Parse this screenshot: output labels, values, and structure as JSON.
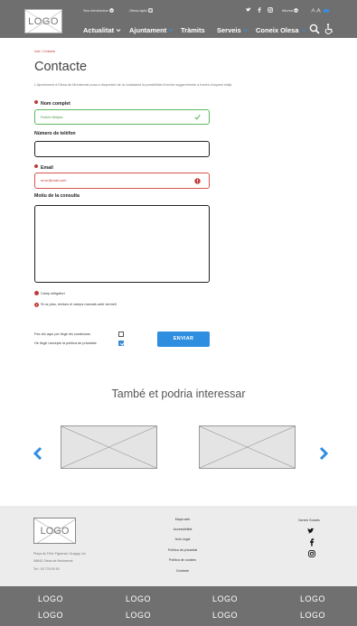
{
  "header": {
    "logo_text": "LOGO",
    "topbar": {
      "seu_electronica": "Seu electrònica",
      "olesa_aplic": "Olesa Aplic",
      "idioma": "Idioma"
    },
    "nav": {
      "actualitat": "Actualitat",
      "ajuntament": "Ajuntament",
      "tramits": "Tràmits",
      "serveis": "Serveis",
      "coneix_olesa": "Coneix Olesa"
    },
    "icons": [
      "twitter-icon",
      "facebook-icon",
      "instagram-icon",
      "search-icon",
      "accessibility-icon"
    ],
    "accent_color": "#3c8ad6"
  },
  "breadcrumb": "Inici / Contacte",
  "page_title": "Contacte",
  "intro": "L'Ajuntament d'Olesa de Montserrat posa a disposició de la ciutadania la possibilitat d'enviar suggeriments a través d'aquest mitjà.",
  "form": {
    "name_label": "Nom complet",
    "name_value": "Rubén Mejias",
    "phone_label": "Número de telèfon",
    "phone_value": "",
    "email_label": "Email",
    "email_value": "error@mail.com",
    "message_label": "Motiu de la consulta",
    "message_value": "",
    "required_note": "Camp obligatori",
    "error_note": "Si us plau, reviseu el camps marcats amb vermell",
    "conditions_label": "Fes clic aquí per llegir les condicions",
    "conditions_checked": false,
    "privacy_label": "He llegit i accepto la política de privacitat",
    "privacy_checked": true,
    "submit_label": "ENVIAR",
    "ok_color": "#5cb85c",
    "error_color": "#d9534f"
  },
  "related": {
    "title": "També et podria interessar",
    "prev_icon": "chevron-left-icon",
    "next_icon": "chevron-right-icon"
  },
  "footer": {
    "logo_text": "LOGO",
    "address_line1": "Plaça de Fèlix Figueras i Aragay, s/n",
    "address_line2": "08640 Olesa de Montserrat",
    "phone": "Tel.: 93 778 00 50",
    "links": [
      "Mapa web",
      "Accessibilitat",
      "Avís Legal",
      "Política de privacitat",
      "Política de cookies",
      "Contacte"
    ],
    "social_title": "Xarxes Socials",
    "social_icons": [
      "twitter-icon",
      "facebook-icon",
      "instagram-icon"
    ]
  },
  "logo_bar": {
    "items": [
      "LOGO",
      "LOGO",
      "LOGO",
      "LOGO",
      "LOGO",
      "LOGO",
      "LOGO",
      "LOGO"
    ]
  }
}
